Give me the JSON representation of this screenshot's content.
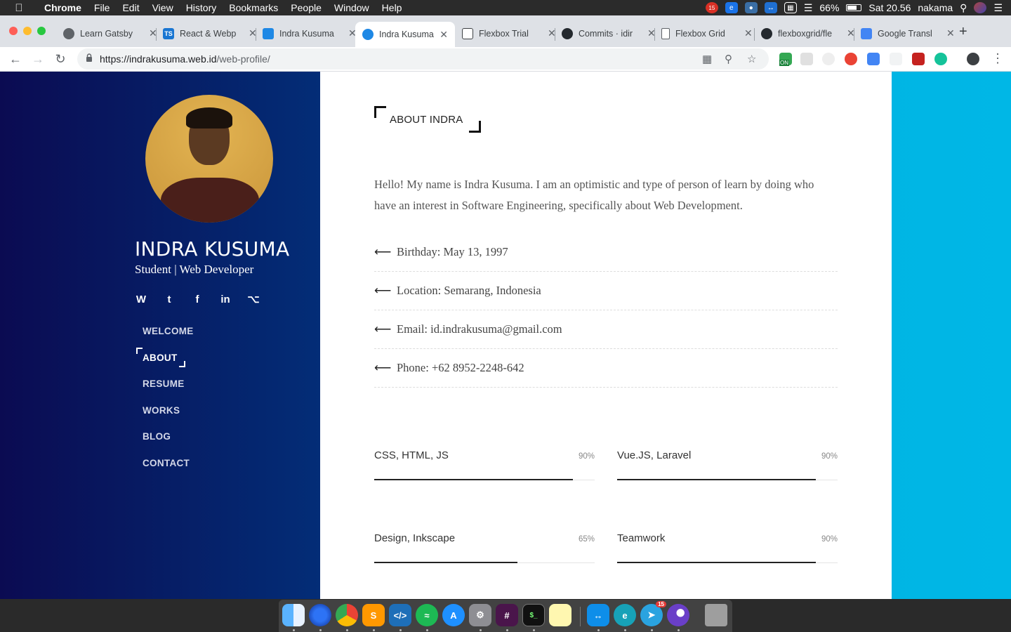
{
  "menubar": {
    "app": "Chrome",
    "items": [
      "File",
      "Edit",
      "View",
      "History",
      "Bookmarks",
      "People",
      "Window",
      "Help"
    ],
    "battery": "66%",
    "clock": "Sat 20.56",
    "user": "nakama",
    "calendar_badge": "15"
  },
  "tabs": [
    {
      "title": "Learn Gatsby",
      "favicon": "gatsby-icon",
      "active": false
    },
    {
      "title": "React & Webp",
      "favicon": "ts-icon",
      "active": false
    },
    {
      "title": "Indra Kusuma",
      "favicon": "site-icon",
      "active": false
    },
    {
      "title": "Indra Kusuma",
      "favicon": "site-icon",
      "active": true
    },
    {
      "title": "Flexbox Trial",
      "favicon": "codepen-icon",
      "active": false
    },
    {
      "title": "Commits · idir",
      "favicon": "github-icon",
      "active": false
    },
    {
      "title": "Flexbox Grid",
      "favicon": "doc-icon",
      "active": false
    },
    {
      "title": "flexboxgrid/fle",
      "favicon": "github-icon",
      "active": false
    },
    {
      "title": "Google Transl",
      "favicon": "translate-icon",
      "active": false
    }
  ],
  "tab_favicon_text": {
    "ts": "TS"
  },
  "address": {
    "host": "https://indrakusuma.web.id",
    "path": "/web-profile/"
  },
  "extension_badge": "ON",
  "profile": {
    "name": "INDRA KUSUMA",
    "role": "Student | Web Developer",
    "socials": [
      "wordpress-icon",
      "twitter-icon",
      "facebook-icon",
      "linkedin-icon",
      "github-icon"
    ],
    "social_glyphs": [
      "W",
      "t",
      "f",
      "in",
      "⌥"
    ]
  },
  "nav": {
    "items": [
      "WELCOME",
      "ABOUT",
      "RESUME",
      "WORKS",
      "BLOG",
      "CONTACT"
    ],
    "active": "ABOUT"
  },
  "about": {
    "heading": "ABOUT INDRA",
    "intro": "Hello! My name is Indra Kusuma. I am an optimistic and type of person of learn by doing who have an interest in Software Engineering, specifically about Web Development.",
    "details": [
      "Birthday: May 13, 1997",
      "Location: Semarang, Indonesia",
      "Email: id.indrakusuma@gmail.com",
      "Phone: +62 8952-2248-642"
    ]
  },
  "skills": [
    {
      "name": "CSS, HTML, JS",
      "percent_label": "90%",
      "percent": 90
    },
    {
      "name": "Vue.JS, Laravel",
      "percent_label": "90%",
      "percent": 90
    },
    {
      "name": "Design, Inkscape",
      "percent_label": "65%",
      "percent": 65
    },
    {
      "name": "Teamwork",
      "percent_label": "90%",
      "percent": 90
    }
  ],
  "dock": {
    "apps": [
      "finder",
      "firefox",
      "chrome",
      "sublime",
      "vscode",
      "spotify",
      "app-store",
      "system-preferences",
      "slack",
      "terminal",
      "notes",
      "teamviewer",
      "evernote",
      "telegram",
      "vpn",
      "trash"
    ],
    "terminal_text": "$_",
    "telegram_badge": "15"
  },
  "colors": {
    "sidebar_start": "#0b0b52",
    "sidebar_end": "#032d77",
    "right_band": "#00b0e0",
    "accent_text": "#222222"
  }
}
